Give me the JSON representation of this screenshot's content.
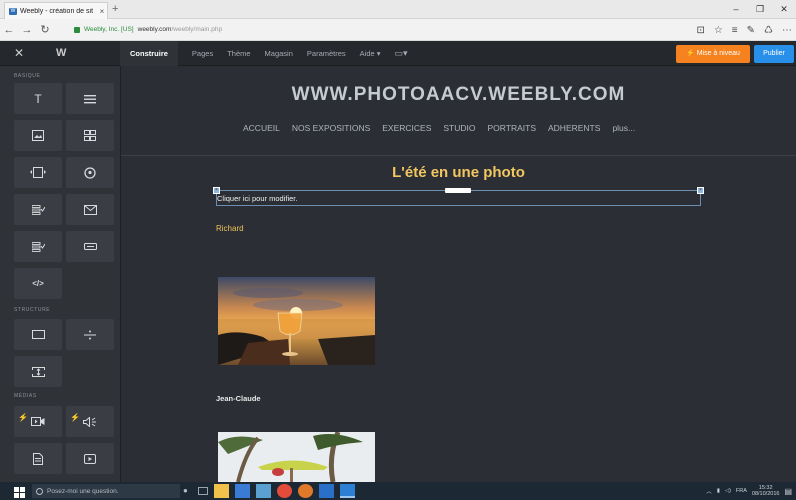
{
  "browser": {
    "tab_title": "Weebly - création de sit",
    "tab_close": "×",
    "new_tab": "+",
    "identity": "Weebly, Inc. [US]",
    "url_host": "weebly.com",
    "url_path": "/weebly/main.php",
    "window_controls": [
      "–",
      "❐",
      "✕"
    ],
    "nav": [
      "←",
      "→",
      "↻"
    ],
    "tools": [
      "⊡",
      "☆",
      "≡",
      "✎",
      "♺",
      "⋯"
    ]
  },
  "weebly": {
    "close": "✕",
    "logo": "W",
    "nav": [
      "Construire",
      "Pages",
      "Thème",
      "Magasin",
      "Paramètres",
      "Aide ▾"
    ],
    "upgrade_label": "⚡ Mise à niveau",
    "publish_label": "Publier"
  },
  "sidebar": {
    "sections": [
      "BASIQUE",
      "STRUCTURE",
      "MÉDIAS"
    ],
    "tiles": [
      {
        "icon": "title-icon"
      },
      {
        "icon": "text-icon"
      },
      {
        "icon": "image-icon"
      },
      {
        "icon": "gallery-icon"
      },
      {
        "icon": "slideshow-icon"
      },
      {
        "icon": "map-icon"
      },
      {
        "icon": "form-icon"
      },
      {
        "icon": "contact-form-icon"
      },
      {
        "icon": "survey-icon"
      },
      {
        "icon": "button-icon"
      },
      {
        "icon": "embed-code-icon",
        "label": "</>"
      },
      {
        "icon": "section-icon"
      },
      {
        "icon": "divider-icon"
      },
      {
        "icon": "spacer-icon"
      },
      {
        "icon": "video-icon"
      },
      {
        "icon": "audio-icon"
      },
      {
        "icon": "document-icon"
      },
      {
        "icon": "youtube-icon"
      }
    ]
  },
  "site": {
    "title": "WWW.PHOTOAACV.WEEBLY.COM",
    "nav": [
      "ACCUEIL",
      "NOS EXPOSITIONS",
      "EXERCICES",
      "STUDIO",
      "PORTRAITS",
      "ADHERENTS",
      "plus..."
    ],
    "heading": "L'été en une photo",
    "edit_hint": "Cliquer ici pour modifier.",
    "author1": "Richard",
    "author2": "Jean-Claude"
  },
  "taskbar": {
    "search_placeholder": "Posez-moi une question.",
    "lang": "FRA",
    "time": "15:32",
    "date": "08/10/2016"
  },
  "colors": {
    "canvas_bg": "#2b2f35",
    "heading": "#f2c661",
    "upgrade": "#f5821f",
    "publish": "#2990ea"
  }
}
